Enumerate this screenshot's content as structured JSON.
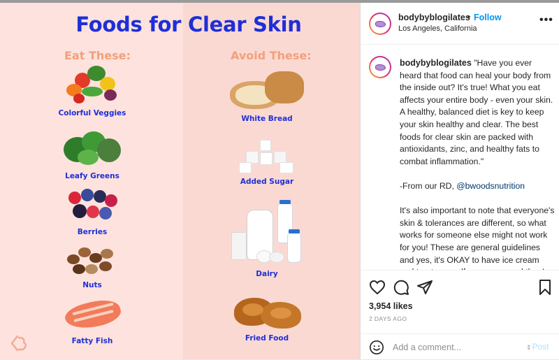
{
  "image": {
    "title": "Foods for Clear Skin",
    "eat_heading": "Eat These:",
    "avoid_heading": "Avoid These:",
    "eat_items": [
      {
        "label": "Colorful Veggies"
      },
      {
        "label": "Leafy Greens"
      },
      {
        "label": "Berries"
      },
      {
        "label": "Nuts"
      },
      {
        "label": "Fatty Fish"
      }
    ],
    "avoid_items": [
      {
        "label": "White Bread"
      },
      {
        "label": "Added Sugar"
      },
      {
        "label": "Dairy"
      },
      {
        "label": "Fried Food"
      }
    ],
    "colors": {
      "title": "#1f2fd6",
      "heading": "#f2a07a",
      "background": "#fde2de"
    }
  },
  "header": {
    "username": "bodybyblogilates",
    "separator": "•",
    "follow_label": "Follow",
    "location": "Los Angeles, California",
    "more_icon": "more-horizontal-icon"
  },
  "caption": {
    "username": "bodybyblogilates",
    "paragraph1": "\"Have you ever heard that food can heal your body from the inside out? It's true! What you eat affects your entire body - even your skin. A healthy, balanced diet is key to keep your skin healthy and clear. The best foods for clear skin are packed with antioxidants, zinc, and healthy fats to combat inflammation.\"",
    "paragraph2_prefix": "-From our RD, ",
    "mention": "@bwoodsnutrition",
    "paragraph3": "It's also important to note that everyone's skin & tolerances are different, so what works for someone else might not work for you! These are general guidelines and yes, it's OKAY to have ice cream and treat yourself every now and then! Ultimately, It's all about balance and consistency. 💚🙂"
  },
  "actions": {
    "icons": [
      "heart-icon",
      "comment-icon",
      "share-icon",
      "bookmark-icon"
    ],
    "likes": "3,954 likes",
    "posted": "2 DAYS AGO"
  },
  "comment": {
    "placeholder": "Add a comment...",
    "post_label": "Post"
  }
}
